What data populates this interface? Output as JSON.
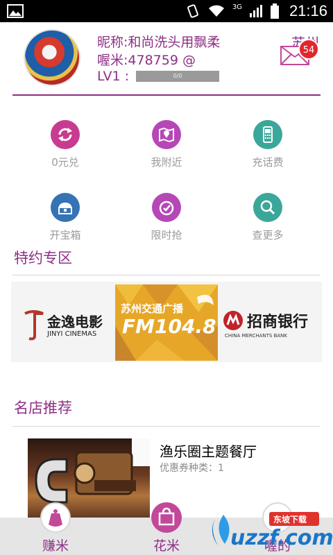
{
  "status_bar": {
    "time": "21:16",
    "network": "3G"
  },
  "profile": {
    "nickname": "昵称:和尚洗头用飘柔",
    "mi_label": "喔米:478759",
    "mi_suffix": "@",
    "level": "LV1 :",
    "progress_text": "0/0",
    "progress": 0,
    "city": "苏州",
    "messages_badge": "54"
  },
  "grid": [
    {
      "label": "0元兑",
      "icon": "refresh-icon",
      "color": "#c73c90"
    },
    {
      "label": "我附近",
      "icon": "map-pin-icon",
      "color": "#b547b6"
    },
    {
      "label": "充话费",
      "icon": "phone-icon",
      "color": "#3aa79a"
    },
    {
      "label": "开宝箱",
      "icon": "treasure-box-icon",
      "color": "#3673b4"
    },
    {
      "label": "限时抢",
      "icon": "clock-icon",
      "color": "#b547b6"
    },
    {
      "label": "查更多",
      "icon": "search-icon",
      "color": "#3aa79a"
    }
  ],
  "special": {
    "title": "特约专区",
    "partners": [
      {
        "name": "金逸电影",
        "sub": "JINYI CINEMAS"
      },
      {
        "name": "苏州交通广播",
        "sub": "FM104.8"
      },
      {
        "name": "招商银行",
        "sub": "CHINA MERCHANTS BANK"
      }
    ]
  },
  "shops": {
    "title": "名店推荐",
    "items": [
      {
        "name": "渔乐圈主题餐厅",
        "coupon": "优惠券种类：1"
      }
    ]
  },
  "bottom_nav": [
    {
      "label": "赚米",
      "icon": "money-bag-icon"
    },
    {
      "label": "花米",
      "icon": "shopping-bag-icon"
    },
    {
      "label": "喔的",
      "icon": "user-icon"
    }
  ],
  "watermark": {
    "text": "uzzf.com",
    "sub": "东坡下载"
  },
  "colors": {
    "accent": "#8e2f86",
    "badge": "#e2262b"
  }
}
